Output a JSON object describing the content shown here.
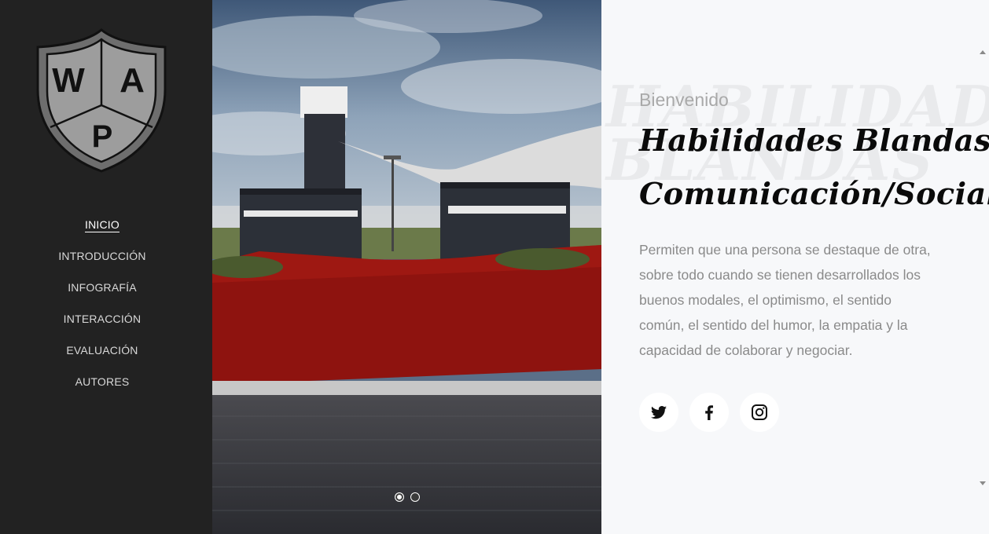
{
  "logo": {
    "letters": [
      "W",
      "A",
      "P"
    ]
  },
  "nav": {
    "items": [
      {
        "label": "INICIO",
        "active": true
      },
      {
        "label": "INTRODUCCIÓN",
        "active": false
      },
      {
        "label": "INFOGRAFÍA",
        "active": false
      },
      {
        "label": "INTERACCIÓN",
        "active": false
      },
      {
        "label": "EVALUACIÓN",
        "active": false
      },
      {
        "label": "AUTORES",
        "active": false
      }
    ]
  },
  "slider": {
    "slide_count": 2,
    "active_slide": 1
  },
  "hero": {
    "background_words": [
      "HABILIDADES",
      "BLANDAS"
    ],
    "welcome": "Bienvenido",
    "title_line1": "Habilidades Blandas",
    "title_line2": "Comunicación/Social",
    "description": "Permiten que una persona se destaque de otra, sobre todo cuando se tienen desarrollados los buenos modales, el optimismo, el sentido común, el sentido del humor, la empatia y la capacidad de colaborar y negociar."
  },
  "social": [
    {
      "icon": "twitter-icon"
    },
    {
      "icon": "facebook-icon"
    },
    {
      "icon": "instagram-icon"
    }
  ],
  "colors": {
    "sidebar_bg": "#222222",
    "content_bg": "#f7f8fa",
    "nav_text": "#d9d9d9",
    "title_text": "#0a0a0a",
    "body_text": "#8a8a8a"
  }
}
